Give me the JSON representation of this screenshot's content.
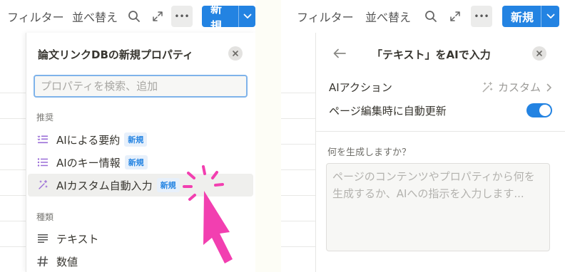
{
  "toolbar": {
    "filter_label": "フィルター",
    "sort_label": "並べ替え",
    "search_icon": "search-icon",
    "expand_icon": "expand-icon",
    "more_label": "•••",
    "new_label": "新規",
    "new_dropdown_icon": "chevron-down-icon"
  },
  "property_menu": {
    "title": "論文リンクDBの新規プロパティ",
    "close_icon": "close-icon",
    "search_placeholder": "プロパティを検索、追加",
    "section_recommended": "推奨",
    "recommended_items": [
      {
        "label": "AIによる要約",
        "badge": "新規",
        "icon": "ai-summary-icon"
      },
      {
        "label": "AIのキー情報",
        "badge": "新規",
        "icon": "ai-keyinfo-icon"
      },
      {
        "label": "AIカスタム自動入力",
        "badge": "新規",
        "icon": "sparkle-icon"
      }
    ],
    "section_types": "種類",
    "type_items": [
      {
        "label": "テキスト",
        "icon": "text-lines-icon"
      },
      {
        "label": "数値",
        "icon": "hash-icon"
      }
    ]
  },
  "ai_panel": {
    "back_icon": "back-arrow-icon",
    "title": "「テキスト」をAIで入力",
    "close_icon": "close-icon",
    "action_label": "AIアクション",
    "action_value": "カスタム",
    "auto_update_label": "ページ編集時に自動更新",
    "auto_update_on": true,
    "prompt_question": "何を生成しますか？",
    "prompt_placeholder": "ページのコンテンツやプロパティから何を生成するか、AIへの指示を入力します..."
  },
  "colors": {
    "accent": "#2383e2",
    "cursor": "#f23fb0",
    "badge_bg": "#e7f0fb"
  }
}
